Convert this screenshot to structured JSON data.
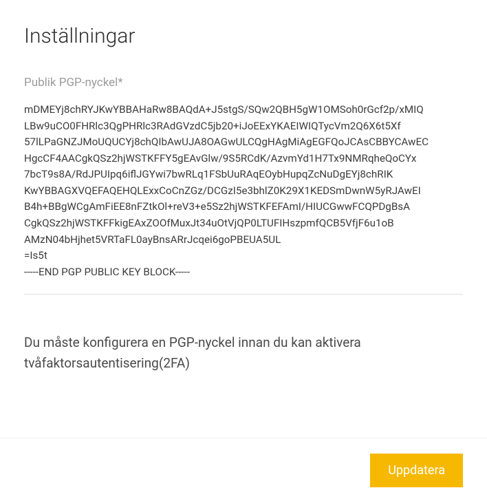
{
  "header": {
    "title": "Inställningar"
  },
  "form": {
    "pgp_label": "Publik PGP-nyckel*",
    "pgp_value": "mDMEYj8chRYJKwYBBAHaRw8BAQdA+J5stgS/SQw2QBH5gW1OMSoh0rGcf2p/xMIQ\nLBw9uCO0FHRlc3QgPHRlc3RAdGVzdC5jb20+iJoEExYKAEIWIQTycVm2Q6X6t5Xf\n57lLPaGNZJMoUQUCYj8chQIbAwUJA8OAGwULCQgHAgMiAgEGFQoJCAsCBBYCAwEC\nHgcCF4AACgkQSz2hjWSTKFFY5gEAvGlw/9S5RCdK/AzvmYd1H7Tx9NMRqheQoCYx\n7bcT9s8A/RdJPUIpq6iflJGYwi7bwRLq1FSbUuRAqEOybHupqZcNuDgEYj8chRIK\nKwYBBAGXVQEFAQEHQLExxCoCnZGz/DCGzI5e3bhlZ0K29X1KEDSmDwnW5yRJAwEI\nB4h+BBgWCgAmFiEE8nFZtkOl+reV3+e5Sz2hjWSTKFEFAmI/HIUCGwwFCQPDgBsA\nCgkQSz2hjWSTKFFkigEAxZOOfMuxJt34uOtVjQP0LTUFIHszpmfQCB5VfjF6u1oB\nAMzN04bHjhet5VRTaFL0ayBnsARrJcqei6goPBEUA5UL\n=Is5t\n-----END PGP PUBLIC KEY BLOCK-----",
    "info_text": "Du måste konfigurera en PGP-nyckel innan du kan aktivera tvåfaktorsautentisering(2FA)"
  },
  "footer": {
    "update_label": "Uppdatera"
  }
}
